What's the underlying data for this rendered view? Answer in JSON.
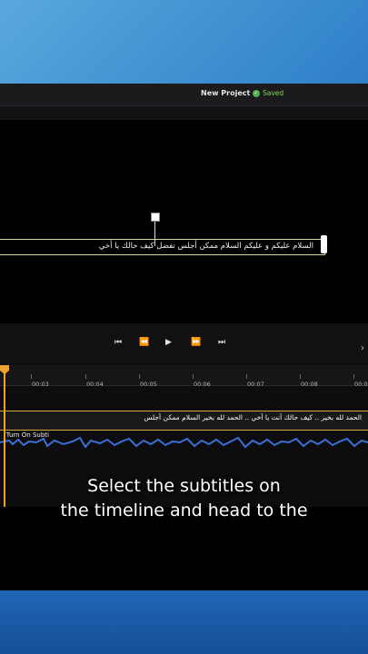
{
  "header": {
    "project_name": "New Project",
    "saved_label": "Saved"
  },
  "preview": {
    "caption": "السلام عليكم و عليكم السلام ممكن أجلس تفضل كيف حالك يا أخي"
  },
  "controls": {
    "skip_back_icon": "⏮",
    "rewind_icon": "⏪",
    "play_icon": "▶",
    "forward_icon": "⏩",
    "skip_forward_icon": "⏭"
  },
  "timeline": {
    "ticks": [
      "00:03",
      "00:04",
      "00:05",
      "00:06",
      "00:07",
      "00:08",
      "00:0"
    ],
    "subtitle_track_text": "الحمد لله بخير .. كيف حالك أنت يا أخي .. الحمد لله بخير السلام ممكن أجلس",
    "clip_label": "(Turn On Subti"
  },
  "overlay": {
    "line1": "Select the subtitles on",
    "line2": "the timeline and head to the"
  },
  "colors": {
    "accent": "#f0a030",
    "saved_green": "#4caf50",
    "waveform": "#3b6fd6"
  }
}
